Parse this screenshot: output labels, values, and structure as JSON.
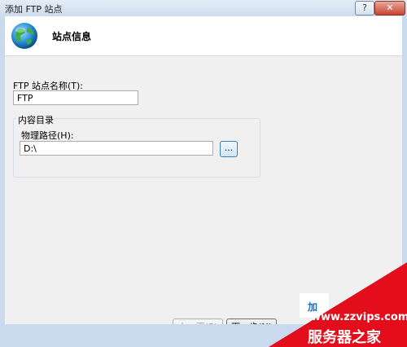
{
  "window": {
    "title": "添加 FTP 站点",
    "help_label": "?",
    "close_label": "✕"
  },
  "header": {
    "title": "站点信息",
    "icon": "globe-icon"
  },
  "form": {
    "site_name_label": "FTP 站点名称(T):",
    "site_name_value": "FTP",
    "content_dir_label": "内容目录",
    "physical_path_label": "物理路径(H):",
    "physical_path_value": "D:\\",
    "browse_label": "..."
  },
  "buttons": {
    "prev_label": "上一页(P)",
    "next_label": "下一步(N)"
  },
  "watermark": {
    "char": "加",
    "url": "www.zzvips.com",
    "name": "服务器之家"
  },
  "colors": {
    "watermark_red": "#e30d1b",
    "accent_blue": "#1a6fc7"
  }
}
